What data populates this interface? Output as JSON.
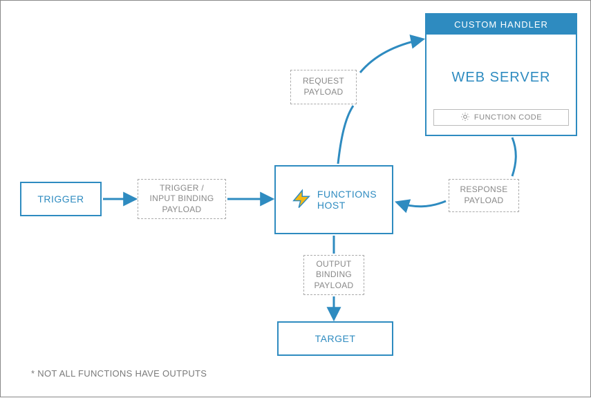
{
  "nodes": {
    "trigger": "TRIGGER",
    "trigger_payload": "TRIGGER /\nINPUT BINDING\nPAYLOAD",
    "functions_host": "FUNCTIONS\nHOST",
    "request_payload": "REQUEST\nPAYLOAD",
    "response_payload": "RESPONSE\nPAYLOAD",
    "output_payload": "OUTPUT\nBINDING\nPAYLOAD",
    "target": "TARGET",
    "custom_handler_header": "CUSTOM HANDLER",
    "web_server": "WEB SERVER",
    "function_code": "FUNCTION CODE"
  },
  "note": "* NOT ALL FUNCTIONS HAVE OUTPUTS",
  "colors": {
    "primary": "#2e8bc0",
    "muted": "#9a9a9a"
  }
}
